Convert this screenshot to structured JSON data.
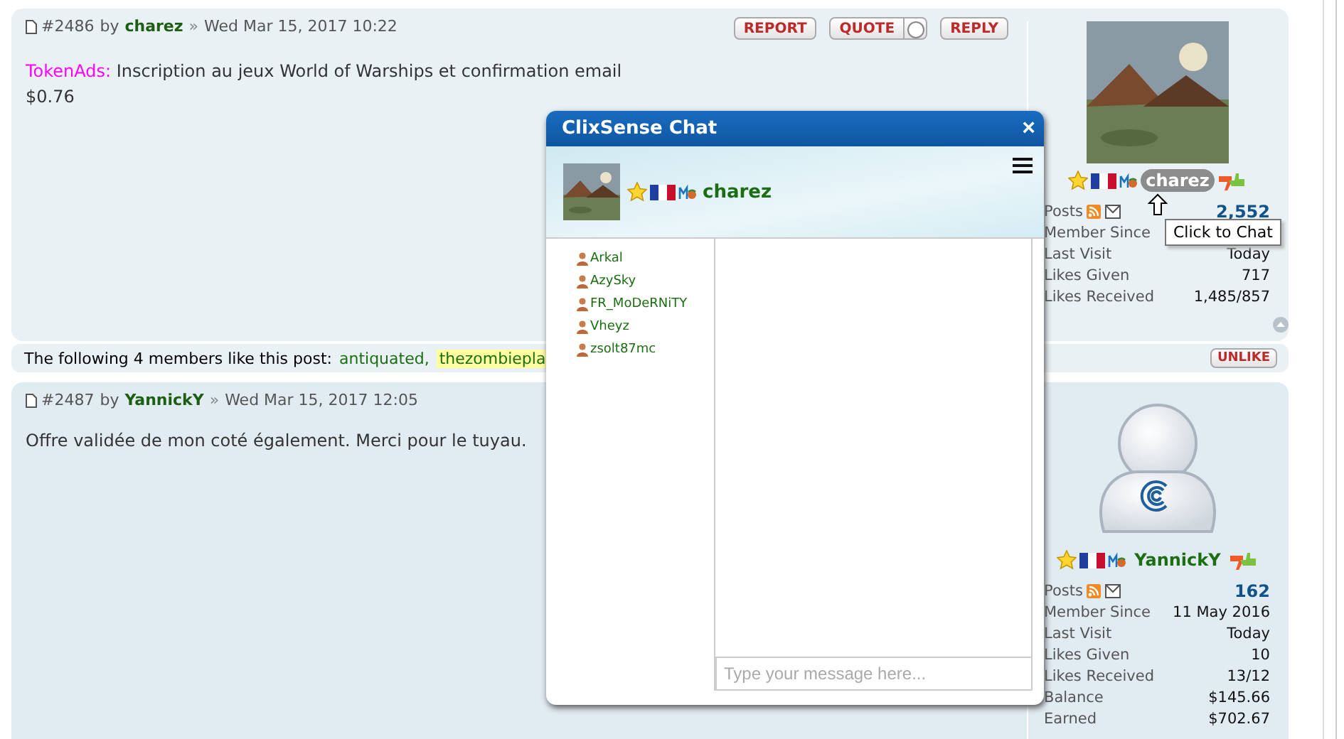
{
  "posts": [
    {
      "number": "#2486",
      "by": "by",
      "author": "charez",
      "separator": "»",
      "date": "Wed Mar 15, 2017 10:22",
      "buttons": [
        {
          "label": "REPORT",
          "kind": "plain"
        },
        {
          "label": "QUOTE",
          "kind": "toggle",
          "on": false
        },
        {
          "label": "REPLY",
          "kind": "plain"
        }
      ],
      "body": [
        {
          "source": "TokenAds:",
          "text": "Inscription au jeux World of Warships et confirmation email"
        },
        {
          "text": "$0.76"
        }
      ],
      "profile": {
        "name": "charez",
        "highlighted": true,
        "tooltip": "Click to Chat",
        "stats": [
          {
            "label": "Posts",
            "kind": "posts",
            "value": "2,552"
          },
          {
            "label": "Member Since",
            "kind": "text"
          },
          {
            "label": "Last Visit",
            "kind": "text",
            "value": "Today"
          },
          {
            "label": "Likes Given",
            "kind": "text",
            "value": "717"
          },
          {
            "label": "Likes Received",
            "kind": "text",
            "value": "1,485/857"
          }
        ]
      },
      "likes": {
        "text": "The following 4 members like this post:",
        "members": [
          {
            "name": "antiquated,",
            "highlighted": false
          },
          {
            "name": "thezombiepla",
            "highlighted": true
          }
        ],
        "button": "UNLIKE"
      }
    },
    {
      "number": "#2487",
      "by": "by",
      "author": "YannickY",
      "separator": "»",
      "date": "Wed Mar 15, 2017 12:05",
      "body": [
        {
          "text": "Offre validée de mon coté également. Merci pour le tuyau."
        }
      ],
      "profile": {
        "avatar": {
          "kind": "default"
        },
        "name": "YannickY",
        "highlighted": false,
        "stats": [
          {
            "label": "Posts",
            "kind": "posts",
            "value": "162"
          },
          {
            "label": "Member Since",
            "kind": "text",
            "value": "11 May 2016"
          },
          {
            "label": "Last Visit",
            "kind": "text",
            "value": "Today"
          },
          {
            "label": "Likes Given",
            "kind": "text",
            "value": "10"
          },
          {
            "label": "Likes Received",
            "kind": "text",
            "value": "13/12"
          },
          {
            "label": "Balance",
            "kind": "text",
            "value": "$145.66"
          },
          {
            "label": "Earned",
            "kind": "text",
            "value": "$702.67"
          }
        ]
      }
    }
  ],
  "chat": {
    "title": "ClixSense Chat",
    "close": "×",
    "user": "charez",
    "users": [
      "Arkal",
      "AzySky",
      "FR_MoDeRNiTY",
      "Vheyz",
      "zsolt87mc"
    ],
    "placeholder": "Type your message here..."
  }
}
